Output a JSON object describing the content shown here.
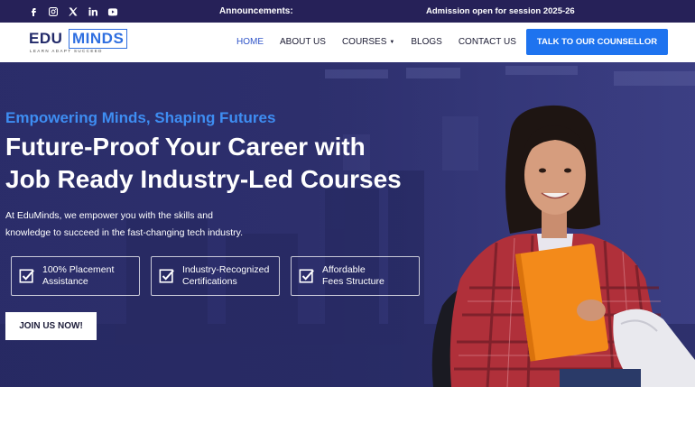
{
  "topbar": {
    "social_icons": [
      "facebook-icon",
      "instagram-icon",
      "x-icon",
      "linkedin-icon",
      "youtube-icon"
    ],
    "announcement_label": "Announcements:",
    "announcement_text": "Admission open for session 2025-26"
  },
  "header": {
    "logo": {
      "edu": "EDU",
      "minds": "MINDS",
      "tagline": "LEARN ADAPT SUCCEED"
    },
    "nav": [
      {
        "label": "HOME",
        "active": true
      },
      {
        "label": "ABOUT US",
        "active": false
      },
      {
        "label": "COURSES",
        "active": false,
        "dropdown": true
      },
      {
        "label": "BLOGS",
        "active": false
      },
      {
        "label": "CONTACT US",
        "active": false
      }
    ],
    "cta_label": "TALK TO OUR COUNSELLOR"
  },
  "hero": {
    "eyebrow": "Empowering Minds, Shaping Futures",
    "headline_line1": "Future-Proof Your Career with",
    "headline_line2": "Job Ready Industry-Led Courses",
    "description": "At EduMinds, we empower you with the skills and knowledge to succeed in the fast-changing tech industry.",
    "features": [
      {
        "line1": "100% Placement",
        "line2": "Assistance"
      },
      {
        "line1": "Industry-Recognized",
        "line2": "Certifications"
      },
      {
        "line1": "Affordable",
        "line2": "Fees Structure"
      }
    ],
    "join_label": "JOIN US NOW!"
  },
  "colors": {
    "topbar_bg": "#262158",
    "accent_blue": "#1e73ef",
    "eyebrow_blue": "#3e8df2",
    "hero_bg": "#2d2f6c",
    "nav_active": "#2f54c8"
  }
}
